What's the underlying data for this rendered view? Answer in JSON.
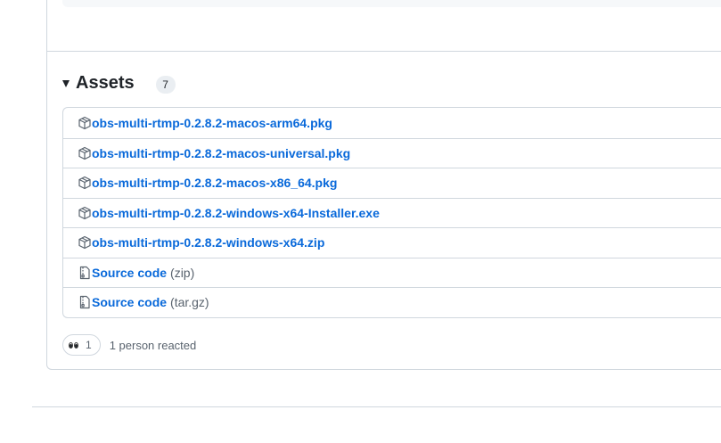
{
  "assets": {
    "title": "Assets",
    "count": "7",
    "items": [
      {
        "name": "obs-multi-rtmp-0.2.8.2-macos-arm64.pkg",
        "suffix": "",
        "icon": "package-icon"
      },
      {
        "name": "obs-multi-rtmp-0.2.8.2-macos-universal.pkg",
        "suffix": "",
        "icon": "package-icon"
      },
      {
        "name": "obs-multi-rtmp-0.2.8.2-macos-x86_64.pkg",
        "suffix": "",
        "icon": "package-icon"
      },
      {
        "name": "obs-multi-rtmp-0.2.8.2-windows-x64-Installer.exe",
        "suffix": "",
        "icon": "package-icon"
      },
      {
        "name": "obs-multi-rtmp-0.2.8.2-windows-x64.zip",
        "suffix": "",
        "icon": "package-icon"
      },
      {
        "name": "Source code",
        "suffix": "(zip)",
        "icon": "file-zip-icon"
      },
      {
        "name": "Source code",
        "suffix": "(tar.gz)",
        "icon": "file-zip-icon"
      }
    ]
  },
  "reactions": {
    "emoji": "eyes-emoji",
    "count": "1",
    "summary": "1 person reacted"
  },
  "colors": {
    "link": "#0969da",
    "border": "#d0d7de",
    "muted": "#59636e",
    "badge_bg": "#eaeef2"
  }
}
